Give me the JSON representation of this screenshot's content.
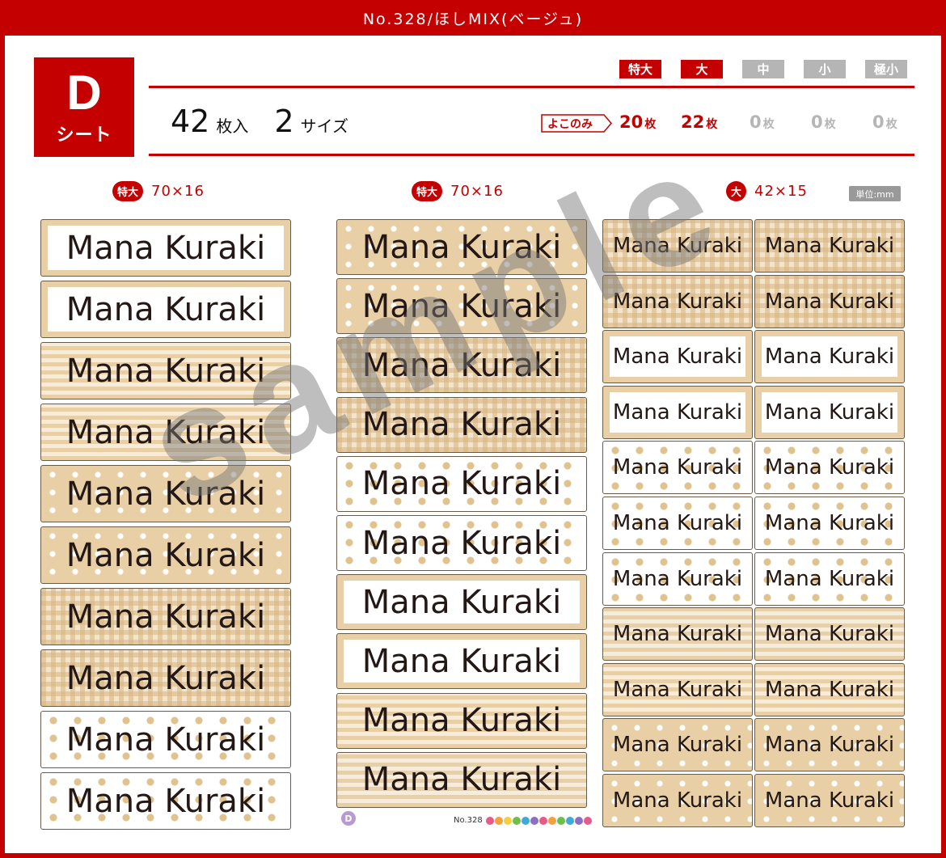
{
  "header": {
    "title": "No.328/ほしMIX(ベージュ)"
  },
  "sheet": {
    "letter": "D",
    "word": "シート"
  },
  "summary": {
    "count": "42",
    "count_unit": "枚入",
    "sizes": "2",
    "sizes_unit": "サイズ"
  },
  "size_chips": [
    {
      "label": "特大",
      "active": true
    },
    {
      "label": "大",
      "active": true
    },
    {
      "label": "中",
      "active": false
    },
    {
      "label": "小",
      "active": false
    },
    {
      "label": "極小",
      "active": false
    }
  ],
  "yoko_label": "よこのみ",
  "quantities": [
    {
      "n": "20",
      "u": "枚",
      "active": true
    },
    {
      "n": "22",
      "u": "枚",
      "active": true
    },
    {
      "n": "0",
      "u": "枚",
      "active": false
    },
    {
      "n": "0",
      "u": "枚",
      "active": false
    },
    {
      "n": "0",
      "u": "枚",
      "active": false
    }
  ],
  "columns": [
    {
      "badge": "特大",
      "dims": "70×16"
    },
    {
      "badge": "特大",
      "dims": "70×16"
    },
    {
      "badge": "大",
      "dims": "42×15"
    }
  ],
  "unit_label": "単位:mm",
  "label_text": "Mana Kuraki",
  "col1_patterns": [
    "solid-inner",
    "solid-inner",
    "stripe",
    "stripe",
    "stars",
    "stars",
    "gingham",
    "gingham",
    "wstars",
    "wstars"
  ],
  "col2_patterns": [
    "stars",
    "stars",
    "gingham",
    "gingham",
    "wstars",
    "wstars",
    "solid-inner",
    "solid-inner",
    "stripe",
    "stripe"
  ],
  "col3_patterns": [
    "gingham",
    "gingham",
    "solid-inner",
    "solid-inner",
    "wstars",
    "wstars",
    "wstars",
    "stripe",
    "stripe",
    "stars",
    "stars"
  ],
  "watermark": "sample",
  "footer": {
    "badge": "D",
    "number": "No.328"
  }
}
